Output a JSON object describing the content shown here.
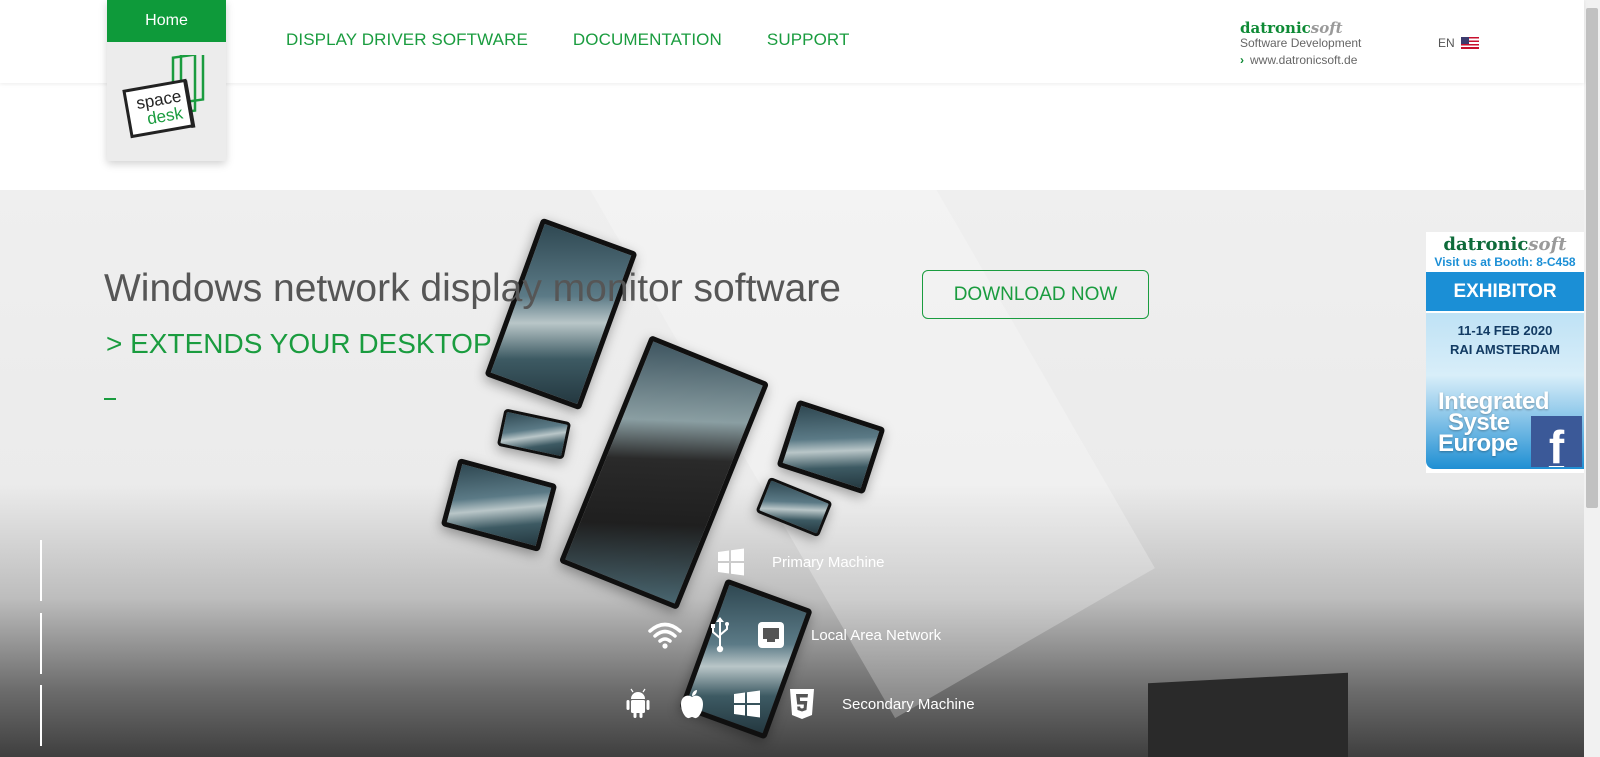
{
  "header": {
    "home_label": "Home",
    "logo_text_1": "space",
    "logo_text_2": "desk",
    "nav": [
      "DISPLAY DRIVER SOFTWARE",
      "DOCUMENTATION",
      "SUPPORT"
    ],
    "company": {
      "brand_main": "datronic",
      "brand_soft": "soft",
      "subtitle": "Software Development",
      "url": "www.datronicsoft.de"
    },
    "language": "EN"
  },
  "hero": {
    "title": "Windows network display monitor software",
    "subtitle": "> EXTENDS YOUR DESKTOP",
    "download_label": "DOWNLOAD NOW",
    "primary_label": "Primary Machine",
    "network_label": "Local Area Network",
    "secondary_label": "Secondary Machine"
  },
  "ad": {
    "brand_main": "datronic",
    "brand_soft": "soft",
    "booth": "Visit us at Booth: 8-C458",
    "exhibitor": "EXHIBITOR",
    "dates": "11-14 FEB 2020",
    "location": "RAI AMSTERDAM",
    "ise_line1": "Integrated",
    "ise_line2": "Syste",
    "ise_line3": "Europe"
  },
  "colors": {
    "accent_green": "#1a9c3f",
    "home_green": "#0e9a3a",
    "ise_blue": "#1b8fd6",
    "facebook_blue": "#3b5998"
  },
  "icons": {
    "primary": [
      "windows-icon"
    ],
    "network": [
      "wifi-icon",
      "usb-icon",
      "ethernet-icon"
    ],
    "secondary": [
      "android-icon",
      "apple-icon",
      "windows-icon",
      "html5-icon"
    ]
  }
}
